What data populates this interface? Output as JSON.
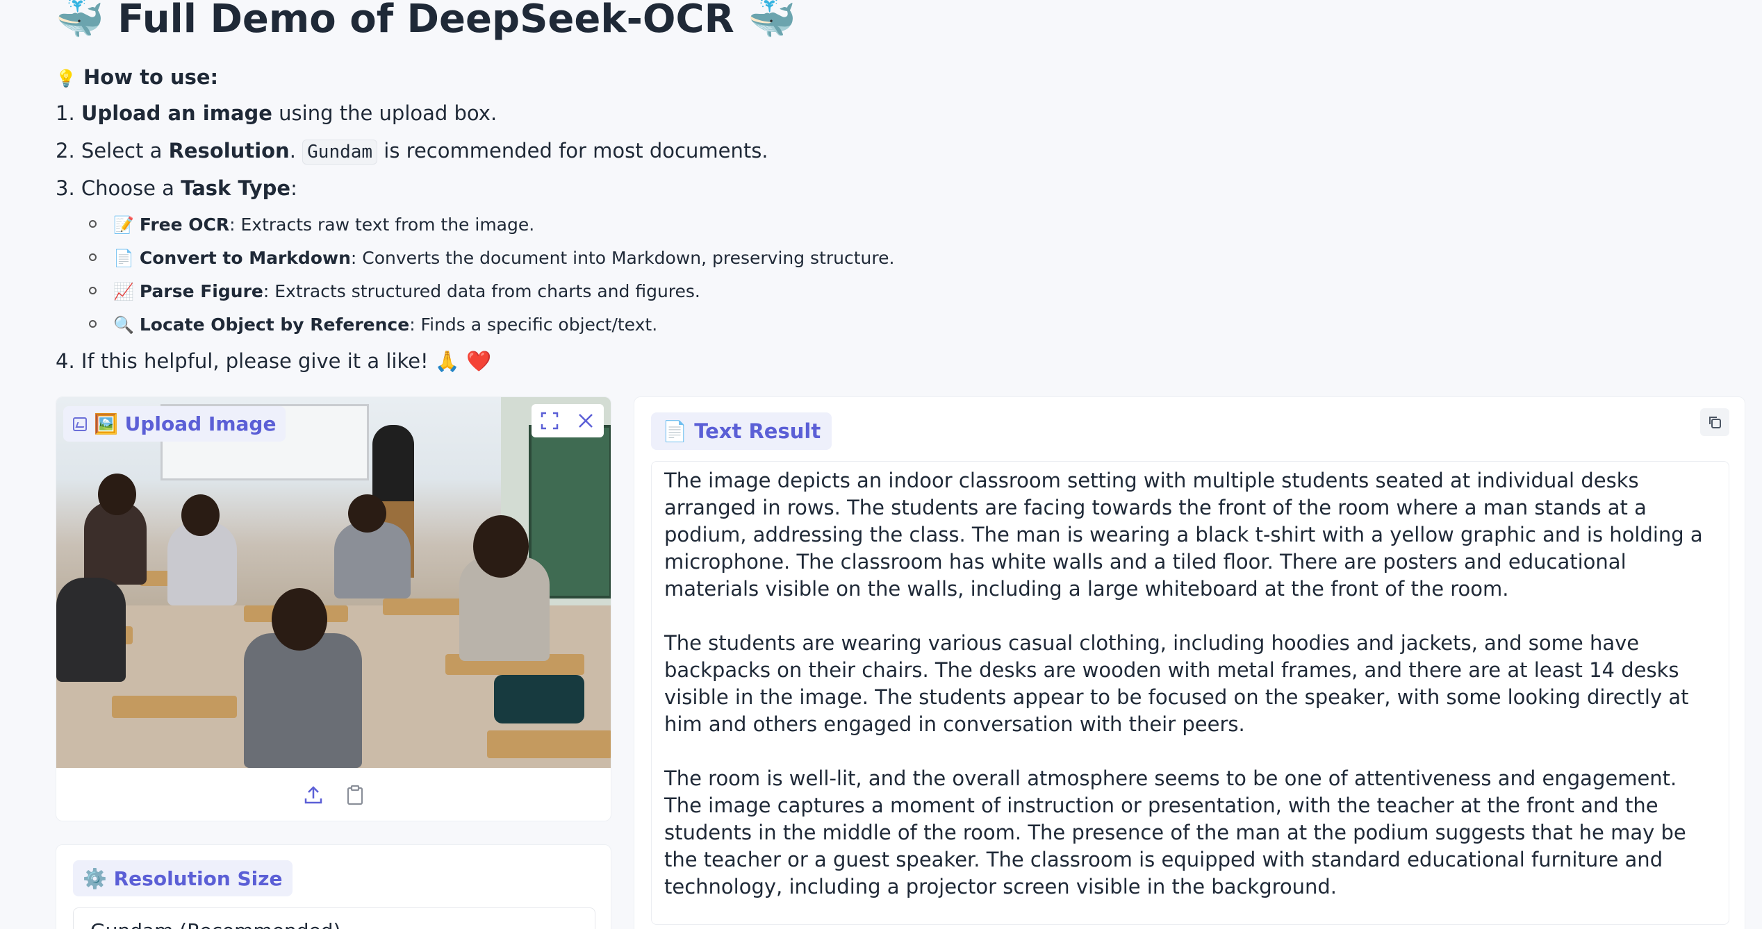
{
  "header": {
    "title": "🐳 Full Demo of DeepSeek-OCR 🐳"
  },
  "instructions": {
    "howto_emoji": "💡",
    "howto_title": "How to use:",
    "step1_num": "1.",
    "step1_bold": "Upload an image",
    "step1_rest": " using the upload box.",
    "step2_num": "2.",
    "step2_pre": "Select a ",
    "step2_bold": "Resolution",
    "step2_mid": ". ",
    "step2_code": "Gundam",
    "step2_rest": " is recommended for most documents.",
    "step3_num": "3.",
    "step3_pre": "Choose a ",
    "step3_bold": "Task Type",
    "step3_rest": ":",
    "tasks": [
      {
        "emoji": "📝",
        "name": "Free OCR",
        "desc": ": Extracts raw text from the image."
      },
      {
        "emoji": "📄",
        "name": "Convert to Markdown",
        "desc": ": Converts the document into Markdown, preserving structure."
      },
      {
        "emoji": "📈",
        "name": "Parse Figure",
        "desc": ": Extracts structured data from charts and figures."
      },
      {
        "emoji": "🔍",
        "name": "Locate Object by Reference",
        "desc": ": Finds a specific object/text."
      }
    ],
    "step4_num": "4.",
    "step4_text": "If this helpful, please give it a like! 🙏 ❤️"
  },
  "upload": {
    "label": "🖼️ Upload Image",
    "fullscreen_icon": "fullscreen-icon",
    "close_icon": "close-icon",
    "upload_icon": "upload-icon",
    "clipboard_icon": "clipboard-icon"
  },
  "resolution": {
    "label": "⚙️ Resolution Size",
    "selected": "Gundam (Recommended)"
  },
  "result": {
    "label": "📄 Text Result",
    "copy_icon": "copy-icon",
    "paragraphs": [
      "The image depicts an indoor classroom setting with multiple students seated at individual desks arranged in rows. The students are facing towards the front of the room where a man stands at a podium, addressing the class. The man is wearing a black t-shirt with a yellow graphic and is holding a microphone. The classroom has white walls and a tiled floor. There are posters and educational materials visible on the walls, including a large whiteboard at the front of the room.",
      "The students are wearing various casual clothing, including hoodies and jackets, and some have backpacks on their chairs. The desks are wooden with metal frames, and there are at least 14 desks visible in the image. The students appear to be focused on the speaker, with some looking directly at him and others engaged in conversation with their peers.",
      "The room is well-lit, and the overall atmosphere seems to be one of attentiveness and engagement. The image captures a moment of instruction or presentation, with the teacher at the front and the students in the middle of the room. The presence of the man at the podium suggests that he may be the teacher or a guest speaker. The classroom is equipped with standard educational furniture and technology, including a projector screen visible in the background."
    ]
  },
  "colors": {
    "accent": "#5b5fd6",
    "label_bg": "#eef0fb",
    "page_bg": "#f7f8fb"
  }
}
